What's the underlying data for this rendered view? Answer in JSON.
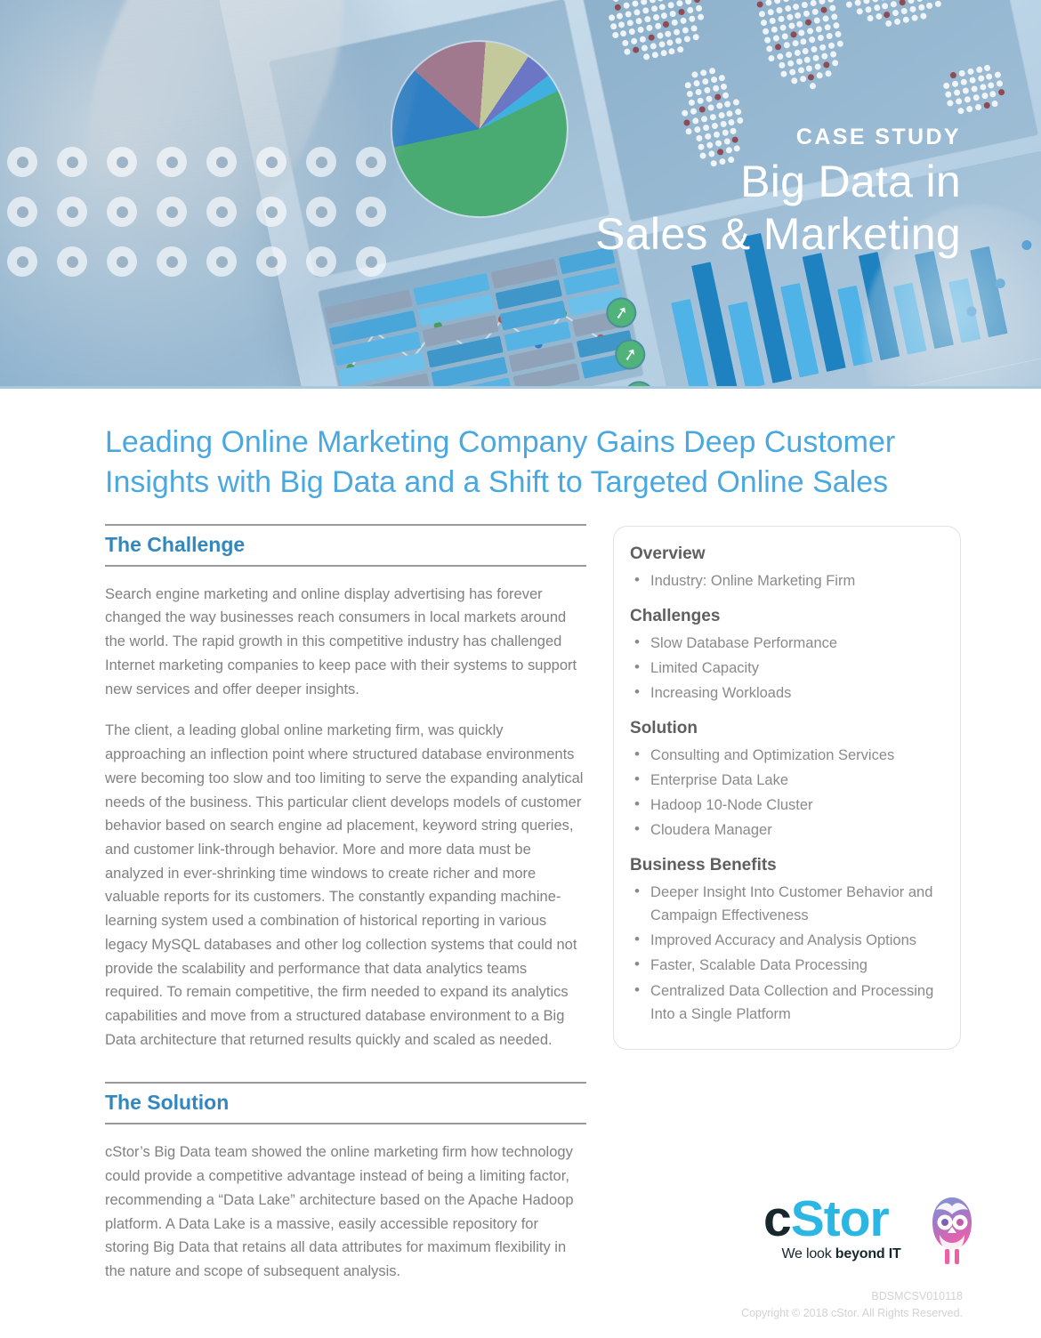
{
  "hero": {
    "kicker": "CASE STUDY",
    "title_line1": "Big Data in",
    "title_line2": "Sales & Marketing",
    "icons": {
      "pie": "pie-chart-icon",
      "map": "world-map-icon",
      "bars": "bar-chart-icon",
      "scatter": "scatter-plot-icon",
      "badge_arrow": "arrow-up-right-icon"
    },
    "badge_glyph": "➚"
  },
  "headline": "Leading Online Marketing Company Gains Deep Customer Insights with Big Data and a Shift to Targeted Online Sales",
  "sections": {
    "challenge": {
      "heading": "The Challenge",
      "paragraphs": [
        "Search engine marketing and online display advertising has forever changed the way businesses reach consumers in local markets around the world. The rapid growth in this competitive industry has challenged Internet marketing companies to keep pace with their systems to support new services and offer deeper insights.",
        "The client, a leading global online marketing firm, was quickly approaching an inflection point where structured database environments were becoming too slow and too limiting to serve the expanding analytical needs of the business. This particular client develops models of customer behavior based on search engine ad placement, keyword string queries, and customer link-through behavior. More and more data must be analyzed in ever-shrinking time windows to create richer and more valuable reports for its customers. The constantly expanding machine-learning system used a combination of historical reporting in various legacy MySQL databases and other log collection systems that could not provide the scalability and performance that data analytics teams required. To remain competitive, the firm needed to expand its analytics capabilities and move from a structured database environment to a Big Data architecture that returned results quickly and scaled as needed."
      ]
    },
    "solution": {
      "heading": "The Solution",
      "paragraphs": [
        "cStor’s Big Data team showed the online marketing firm how technology could provide a competitive advantage instead of being a limiting factor, recommending a “Data Lake” architecture based on the Apache Hadoop platform. A Data Lake is a massive, easily accessible repository for storing Big Data that retains all data attributes for maximum flexibility in the nature and scope of subsequent analysis."
      ]
    }
  },
  "panel": {
    "groups": [
      {
        "heading": "Overview",
        "items": [
          "Industry: Online Marketing Firm"
        ]
      },
      {
        "heading": "Challenges",
        "items": [
          "Slow Database Performance",
          "Limited Capacity",
          "Increasing Workloads"
        ]
      },
      {
        "heading": "Solution",
        "items": [
          "Consulting and Optimization Services",
          "Enterprise Data Lake",
          "Hadoop 10-Node Cluster",
          "Cloudera Manager"
        ]
      },
      {
        "heading": "Business Benefits",
        "items": [
          "Deeper Insight Into Customer Behavior and Campaign Effectiveness",
          "Improved Accuracy and Analysis Options",
          "Faster, Scalable Data Processing",
          "Centralized Data Collection and Processing Into a Single Platform"
        ]
      }
    ]
  },
  "footer": {
    "logo": {
      "word_c": "c",
      "word_stor": "Stor",
      "tagline_light": "We look ",
      "tagline_bold": "beyond IT",
      "mascot": "owl-mascot-icon"
    },
    "doc_code": "BDSMCSV010118",
    "copyright": "Copyright © 2018 cStor. All Rights Reserved."
  },
  "colors": {
    "headline_blue": "#4aa8e0",
    "section_blue": "#3287bf",
    "logo_cyan": "#2bb6e4",
    "logo_dark": "#18272d",
    "body_gray": "#808080",
    "rule_gray": "#9a9a9a",
    "panel_border": "#e2e2e2",
    "bar_dark": "#1e82c0",
    "bar_light": "#4fb3e8",
    "badge_green": "#4fb37a"
  }
}
